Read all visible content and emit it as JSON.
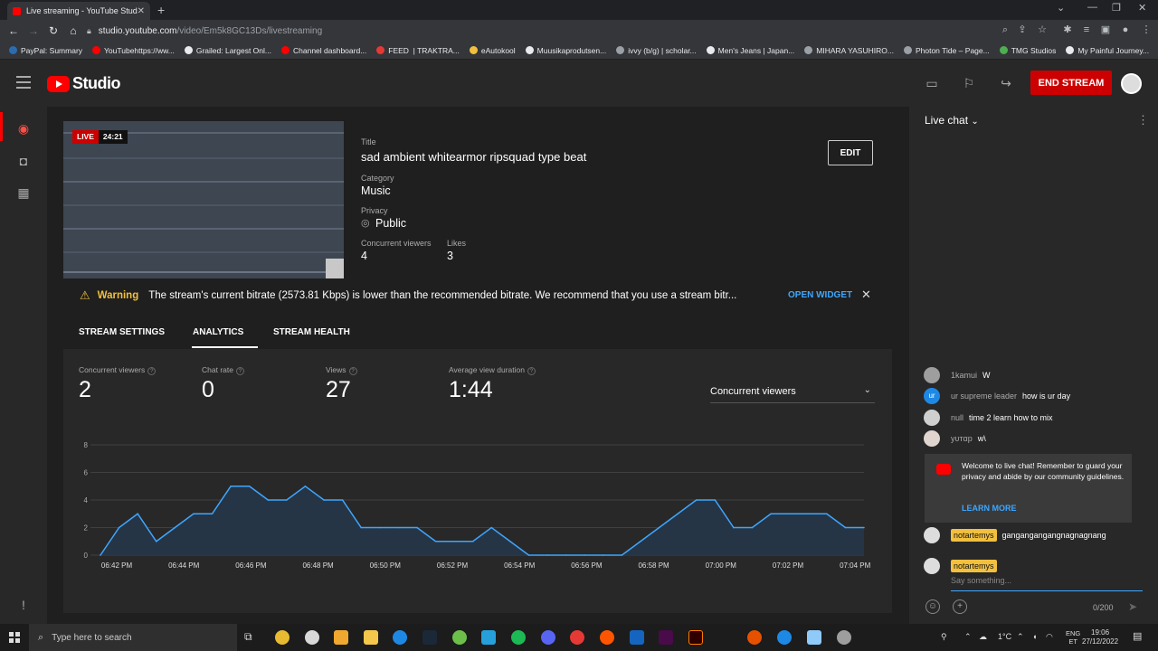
{
  "browser": {
    "tab_title": "Live streaming - YouTube Studio",
    "url_host": "studio.youtube.com",
    "url_path": "/video/Em5k8GC13Ds/livestreaming",
    "bookmarks": [
      {
        "label": "PayPal: Summary",
        "color": "#2b6cb0"
      },
      {
        "label": "YouTubehttps://ww...",
        "color": "#ff0000"
      },
      {
        "label": "Grailed: Largest Onl...",
        "color": "#e8eaed"
      },
      {
        "label": "Channel dashboard...",
        "color": "#ff0000"
      },
      {
        "label": "FEED ️ | TRAKTRA...",
        "color": "#e53935"
      },
      {
        "label": "eAutokool",
        "color": "#f2c03e"
      },
      {
        "label": "Muusikaprodutsen...",
        "color": "#e8eaed"
      },
      {
        "label": "ivvy (b/g) | scholar...",
        "color": "#9aa0a6"
      },
      {
        "label": "Men's Jeans | Japan...",
        "color": "#e8eaed"
      },
      {
        "label": "MIHARA YASUHIRO...",
        "color": "#9aa0a6"
      },
      {
        "label": "Photon Tide – Page...",
        "color": "#9aa0a6"
      },
      {
        "label": "TMG Studios",
        "color": "#4caf50"
      },
      {
        "label": "My Painful Journey...",
        "color": "#e8eaed"
      }
    ]
  },
  "header": {
    "logo_text": "Studio",
    "end_stream_label": "END STREAM"
  },
  "stream": {
    "live_label": "LIVE",
    "elapsed": "24:21",
    "title_label": "Title",
    "title": "sad ambient whitearmor ripsquad type beat",
    "category_label": "Category",
    "category": "Music",
    "privacy_label": "Privacy",
    "privacy": "Public",
    "concurrent_label": "Concurrent viewers",
    "concurrent": "4",
    "likes_label": "Likes",
    "likes": "3",
    "edit_label": "EDIT"
  },
  "warning": {
    "label": "Warning",
    "text": "The stream's current bitrate (2573.81 Kbps) is lower than the recommended bitrate. We recommend that you use a stream bitr...",
    "open_widget": "OPEN WIDGET"
  },
  "tabs": [
    {
      "label": "STREAM SETTINGS"
    },
    {
      "label": "ANALYTICS"
    },
    {
      "label": "STREAM HEALTH"
    }
  ],
  "stats": [
    {
      "label": "Concurrent viewers",
      "value": "2"
    },
    {
      "label": "Chat rate",
      "value": "0"
    },
    {
      "label": "Views",
      "value": "27"
    },
    {
      "label": "Average view duration",
      "value": "1:44"
    }
  ],
  "metric_dropdown": "Concurrent viewers",
  "chart_data": {
    "type": "area",
    "x": [
      "06:41 PM",
      "06:42 PM",
      "06:43 PM",
      "06:43 PM",
      "06:44 PM",
      "06:44 PM",
      "06:45 PM",
      "06:45 PM",
      "06:46 PM",
      "06:46 PM",
      "06:47 PM",
      "06:47 PM",
      "06:48 PM",
      "06:48 PM",
      "06:49 PM",
      "06:49 PM",
      "06:50 PM",
      "06:50 PM",
      "06:51 PM",
      "06:51 PM",
      "06:52 PM",
      "06:52 PM",
      "06:53 PM",
      "06:53 PM",
      "06:54 PM",
      "06:55 PM",
      "06:56 PM",
      "06:57 PM",
      "06:57 PM",
      "06:58 PM",
      "06:58 PM",
      "06:59 PM",
      "06:59 PM",
      "07:00 PM",
      "07:00 PM",
      "07:01 PM",
      "07:01 PM",
      "07:02 PM",
      "07:02 PM",
      "07:03 PM",
      "07:03 PM",
      "07:04 PM"
    ],
    "values": [
      0,
      2,
      3,
      1,
      2,
      3,
      3,
      5,
      5,
      4,
      4,
      5,
      4,
      4,
      2,
      2,
      2,
      2,
      1,
      1,
      1,
      2,
      1,
      0,
      0,
      0,
      0,
      0,
      0,
      1,
      2,
      3,
      4,
      4,
      2,
      2,
      3,
      3,
      3,
      3,
      2,
      2
    ],
    "x_ticks": [
      "06:42 PM",
      "06:44 PM",
      "06:46 PM",
      "06:48 PM",
      "06:50 PM",
      "06:52 PM",
      "06:54 PM",
      "06:56 PM",
      "06:58 PM",
      "07:00 PM",
      "07:02 PM",
      "07:04 PM"
    ],
    "y_ticks": [
      0,
      2,
      4,
      6,
      8
    ],
    "ylim": [
      0,
      8
    ],
    "grid": true,
    "line_color": "#3ea6ff",
    "fill_color": "#263545"
  },
  "chat": {
    "title": "Live chat",
    "messages": [
      {
        "initial": "",
        "name": "1kamui",
        "text": "W",
        "color": "#9e9e9e"
      },
      {
        "initial": "ur",
        "name": "ur supreme leader",
        "text": "how is ur day",
        "color": "#1e88e5"
      },
      {
        "initial": "",
        "name": "null",
        "text": "time 2 learn how to mix",
        "color": "#cfcfcf"
      },
      {
        "initial": "",
        "name": "уυтαр",
        "text": "w\\",
        "color": "#e0d6cf"
      }
    ],
    "welcome_text": "Welcome to live chat! Remember to guard your privacy and abide by our community guidelines.",
    "learn_more": "LEARN MORE",
    "owner_name": "notartemys",
    "owner_message": "gangangangangnagnagnang",
    "compose_name": "notartemys",
    "compose_placeholder": "Say something...",
    "counter": "0/200"
  },
  "taskbar": {
    "search_placeholder": "Type here to search",
    "weather": "1°C",
    "lang": "ENG",
    "region": "ET",
    "time": "19:06",
    "date": "27/12/2022"
  }
}
